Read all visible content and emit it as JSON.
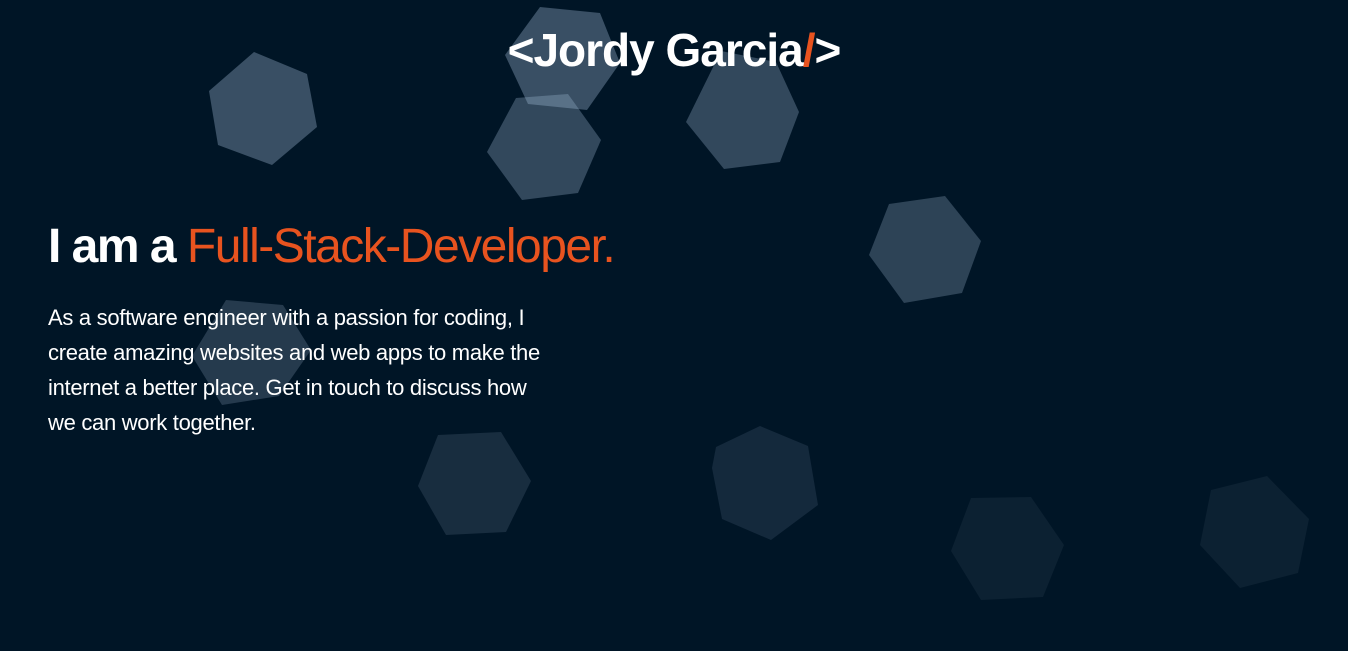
{
  "brand": {
    "open": "<",
    "name": "Jordy Garcia",
    "slash": "/",
    "close": ">"
  },
  "hero": {
    "lead": "I am a ",
    "role": "Full-Stack-Developer.",
    "intro": "As a software engineer with a passion for coding, I create amazing websites and web apps to make the internet a better place. Get in touch to discuss how we can work together."
  },
  "colors": {
    "background": "#001526",
    "accent": "#e8531f",
    "text": "#ffffff",
    "hexagon": "#a7c1db"
  }
}
